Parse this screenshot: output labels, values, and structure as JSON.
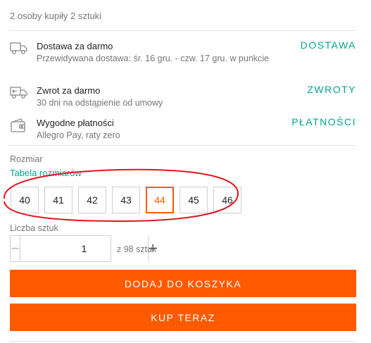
{
  "purchased_note": "2 osoby kupiły 2 sztuki",
  "info": [
    {
      "icon": "truck-icon",
      "title": "Dostawa za darmo",
      "subtitle": "Przewidywana dostawa: śr. 16 gru. - czw. 17 gru. w punkcie",
      "link": "DOSTAWA"
    },
    {
      "icon": "return-truck-icon",
      "title": "Zwrot za darmo",
      "subtitle": "30 dni na odstąpienie od umowy",
      "link": "ZWROTY"
    },
    {
      "icon": "wallet-icon",
      "title": "Wygodne płatności",
      "subtitle": "Allegro Pay, raty zero",
      "link": "PŁATNOŚCI"
    }
  ],
  "size": {
    "label": "Rozmiar",
    "table_link": "Tabela rozmiarów",
    "options": [
      "40",
      "41",
      "42",
      "43",
      "44",
      "45",
      "46"
    ],
    "selected": "44"
  },
  "quantity": {
    "label": "Liczba sztuk",
    "value": "1",
    "minus": "−",
    "plus": "+",
    "stock": "z 98 sztuk"
  },
  "buttons": {
    "add_to_cart": "DODAJ DO KOSZYKA",
    "buy_now": "KUP TERAZ"
  },
  "colors": {
    "accent": "#ff5a00",
    "link": "#00a790",
    "annotation": "#e0161e"
  }
}
